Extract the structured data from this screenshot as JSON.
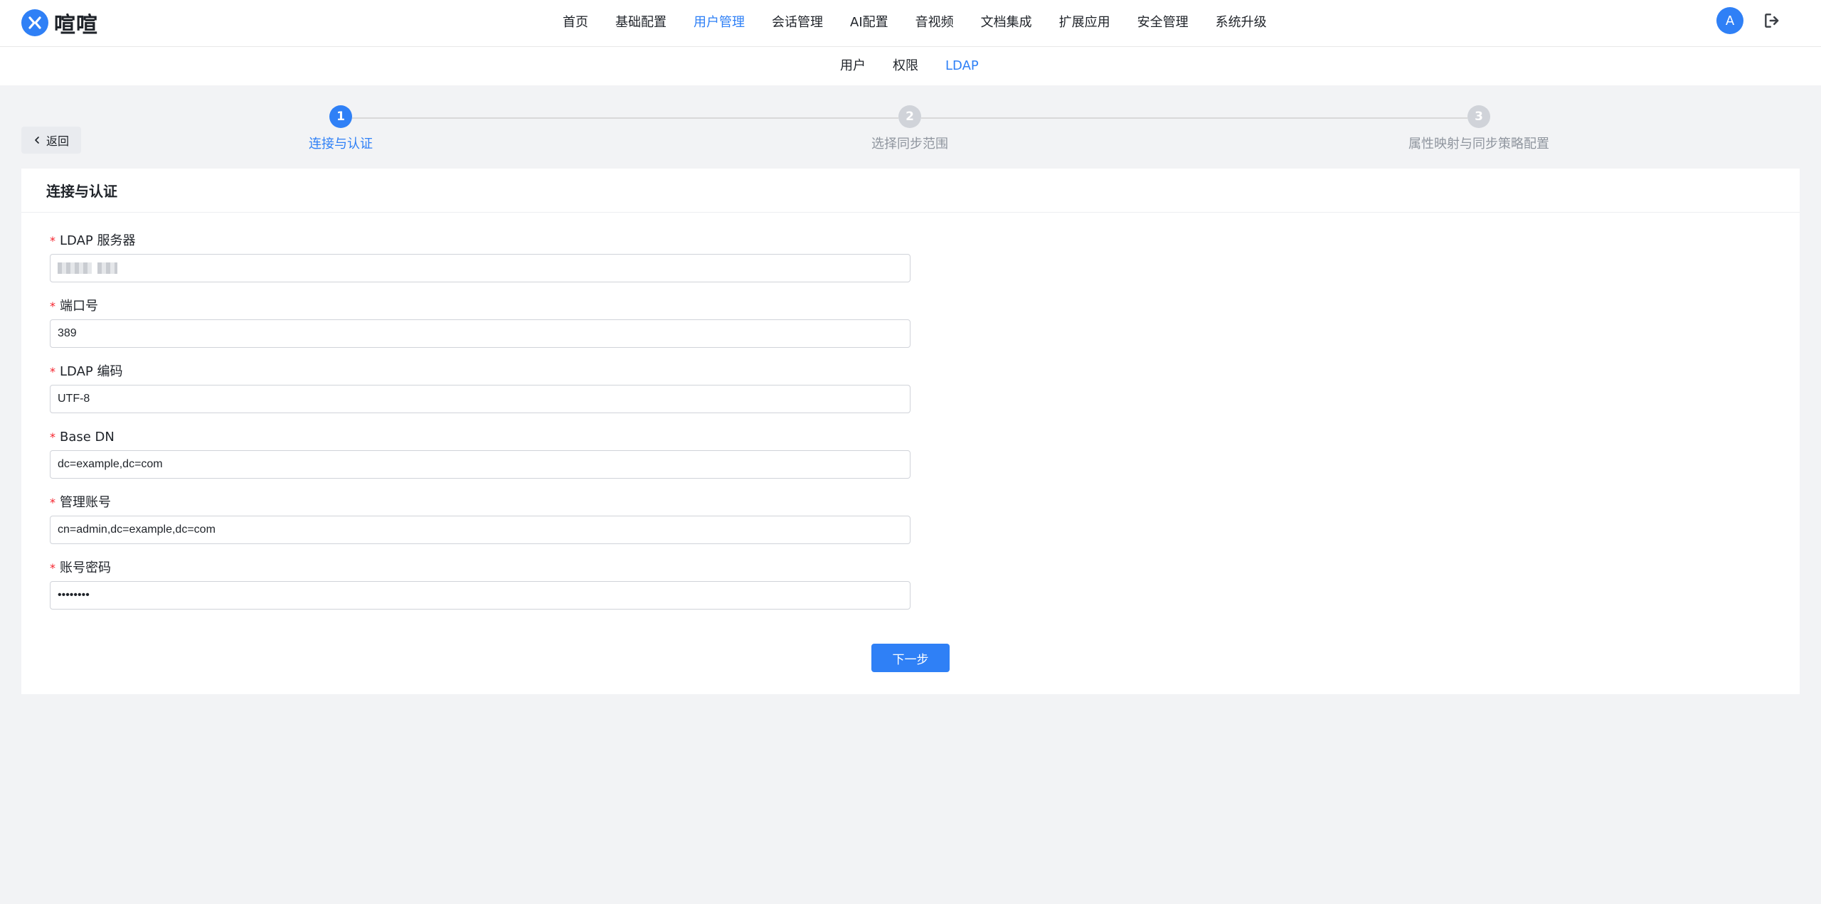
{
  "brand": {
    "name": "喧喧",
    "accent": "#2f80f6"
  },
  "main_nav": [
    {
      "label": "首页",
      "active": false
    },
    {
      "label": "基础配置",
      "active": false
    },
    {
      "label": "用户管理",
      "active": true
    },
    {
      "label": "会话管理",
      "active": false
    },
    {
      "label": "AI配置",
      "active": false
    },
    {
      "label": "音视频",
      "active": false
    },
    {
      "label": "文档集成",
      "active": false
    },
    {
      "label": "扩展应用",
      "active": false
    },
    {
      "label": "安全管理",
      "active": false
    },
    {
      "label": "系统升级",
      "active": false
    }
  ],
  "user": {
    "avatar_letter": "A",
    "logout_icon": "logout-icon"
  },
  "sub_nav": [
    {
      "label": "用户",
      "active": false
    },
    {
      "label": "权限",
      "active": false
    },
    {
      "label": "LDAP",
      "active": true
    }
  ],
  "back_label": "返回",
  "steps": [
    {
      "number": "1",
      "label": "连接与认证",
      "active": true
    },
    {
      "number": "2",
      "label": "选择同步范围",
      "active": false
    },
    {
      "number": "3",
      "label": "属性映射与同步策略配置",
      "active": false
    }
  ],
  "card": {
    "title": "连接与认证"
  },
  "form": {
    "ldap_server": {
      "label": "LDAP 服务器",
      "value": ""
    },
    "port": {
      "label": "端口号",
      "value": "389"
    },
    "encoding": {
      "label": "LDAP 编码",
      "value": "UTF-8"
    },
    "base_dn": {
      "label": "Base DN",
      "value": "dc=example,dc=com"
    },
    "admin_account": {
      "label": "管理账号",
      "value": "cn=admin,dc=example,dc=com"
    },
    "password": {
      "label": "账号密码",
      "value": "••••••••"
    }
  },
  "next_label": "下一步"
}
